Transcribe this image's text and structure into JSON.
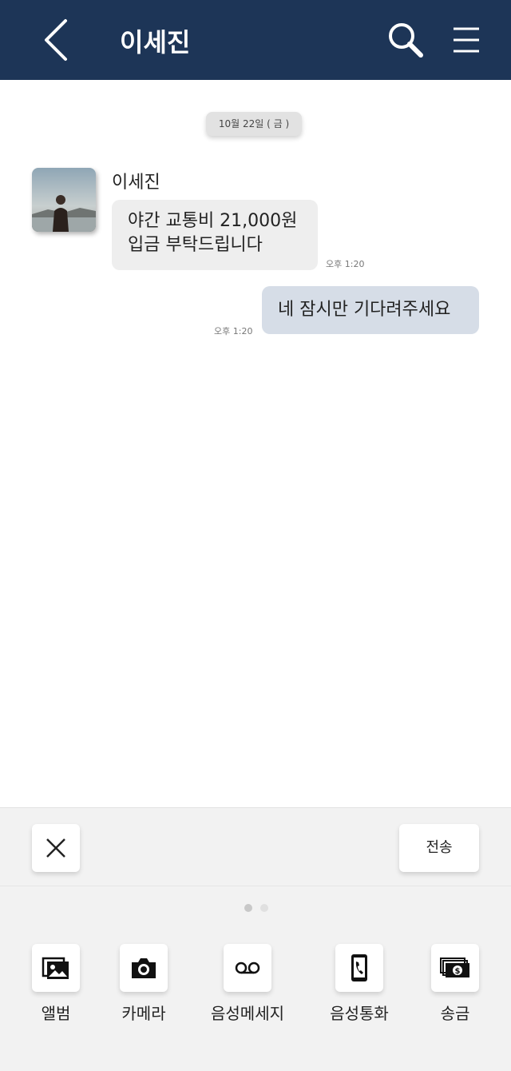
{
  "header": {
    "title": "이세진"
  },
  "chat": {
    "date_chip": "10월 22일 ( 금 )",
    "incoming": {
      "sender": "이세진",
      "line1": "야간 교통비 21,000원",
      "line2": "입금 부탁드립니다",
      "time": "오후 1:20"
    },
    "outgoing": {
      "text": "네 잠시만 기다려주세요",
      "time": "오후 1:20"
    }
  },
  "bottom": {
    "send_label": "전송",
    "actions": [
      {
        "label": "앨범",
        "icon": "album-icon"
      },
      {
        "label": "카메라",
        "icon": "camera-icon"
      },
      {
        "label": "음성메세지",
        "icon": "voicemail-icon"
      },
      {
        "label": "음성통화",
        "icon": "phone-icon"
      },
      {
        "label": "송금",
        "icon": "money-icon"
      }
    ],
    "page_indicator": {
      "current": 1,
      "total": 2
    }
  },
  "colors": {
    "header": "#1d3557",
    "outgoing_bubble": "#d6dde7",
    "incoming_bubble": "#eeeeee"
  }
}
